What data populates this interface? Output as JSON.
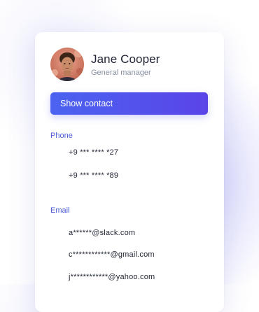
{
  "profile": {
    "name": "Jane Cooper",
    "role": "General manager"
  },
  "actions": {
    "show_contact_label": "Show contact"
  },
  "phone": {
    "label": "Phone",
    "numbers": [
      "+9 *** **** *27",
      "+9 *** **** *89"
    ]
  },
  "email": {
    "label": "Email",
    "addresses": [
      "a******@slack.com",
      "c************@gmail.com",
      "j************@yahoo.com"
    ]
  },
  "colors": {
    "accent": "#4b5ad8",
    "button_start": "#4b63f0",
    "button_end": "#5a44e8"
  }
}
